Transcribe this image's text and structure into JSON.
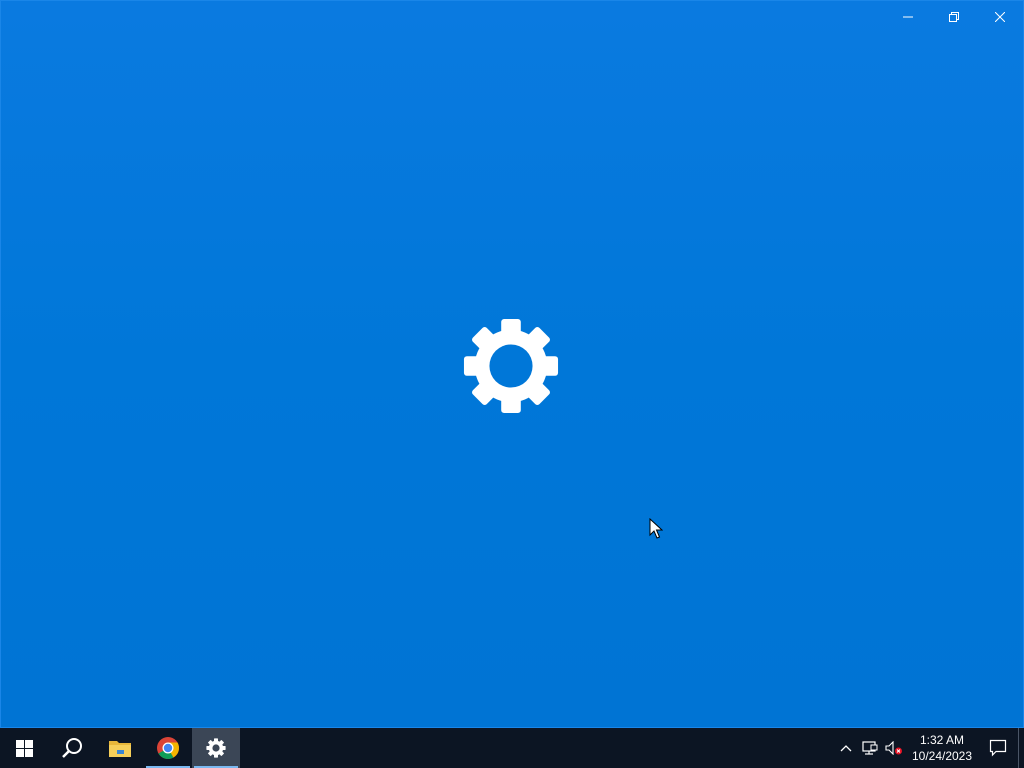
{
  "window": {
    "background": "#0078d7",
    "controls": {
      "minimize_icon": "minimize-icon",
      "restore_icon": "restore-icon",
      "close_icon": "close-icon"
    },
    "splash_icon": "gear-icon"
  },
  "taskbar": {
    "background": "#0c1523",
    "pinned": [
      {
        "name": "start-button",
        "icon": "windows-logo-icon"
      },
      {
        "name": "search-button",
        "icon": "search-icon"
      },
      {
        "name": "file-explorer-button",
        "icon": "folder-icon"
      },
      {
        "name": "chrome-button",
        "icon": "chrome-icon"
      },
      {
        "name": "settings-taskbar-button",
        "icon": "gear-icon",
        "active": true
      }
    ],
    "tray": {
      "icons": [
        "chevron-up-icon",
        "network-icon",
        "volume-muted-icon"
      ],
      "time": "1:32 AM",
      "date": "10/24/2023",
      "notification_icon": "action-center-icon"
    }
  }
}
